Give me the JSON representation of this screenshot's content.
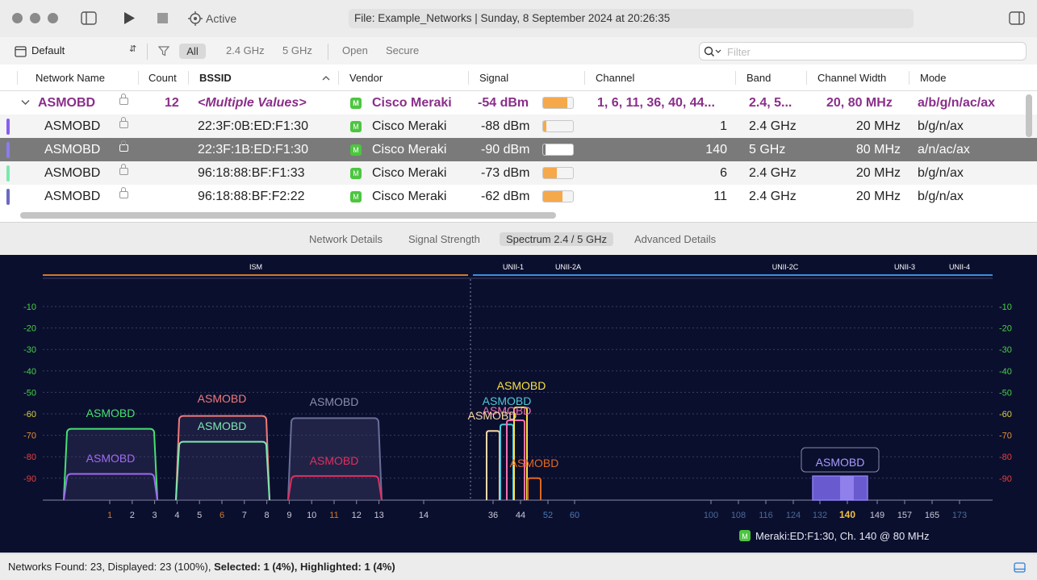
{
  "toolbar": {
    "status_label": "Active",
    "file_info": "File: Example_Networks | Sunday, 8 September 2024 at 20:26:35"
  },
  "filterbar": {
    "profile": "Default",
    "filters": [
      "All",
      "2.4 GHz",
      "5 GHz",
      "Open",
      "Secure"
    ],
    "selected_filter": "All",
    "search_placeholder": "Filter"
  },
  "table": {
    "columns": [
      "Network Name",
      "Count",
      "BSSID",
      "Vendor",
      "Signal",
      "Channel",
      "Band",
      "Channel Width",
      "Mode"
    ],
    "group": {
      "name": "ASMOBD",
      "count": "12",
      "bssid": "<Multiple Values>",
      "vendor": "Cisco Meraki",
      "signal": "-54 dBm",
      "signal_level": 0.8,
      "channel": "1, 6, 11, 36, 40, 44...",
      "band": "2.4, 5...",
      "width": "20, 80 MHz",
      "mode": "a/b/g/n/ac/ax"
    },
    "rows": [
      {
        "name": "ASMOBD",
        "bssid": "22:3F:0B:ED:F1:30",
        "vendor": "Cisco Meraki",
        "signal": "-88 dBm",
        "signal_level": 0.12,
        "channel": "1",
        "band": "2.4 GHz",
        "width": "20 MHz",
        "mode": "b/g/n/ax",
        "color": "#8a5cf0"
      },
      {
        "name": "ASMOBD",
        "bssid": "22:3F:1B:ED:F1:30",
        "vendor": "Cisco Meraki",
        "signal": "-90 dBm",
        "signal_level": 0.08,
        "channel": "140",
        "band": "5 GHz",
        "width": "80 MHz",
        "mode": "a/n/ac/ax",
        "color": "#8a7cf0"
      },
      {
        "name": "ASMOBD",
        "bssid": "96:18:88:BF:F1:33",
        "vendor": "Cisco Meraki",
        "signal": "-73 dBm",
        "signal_level": 0.45,
        "channel": "6",
        "band": "2.4 GHz",
        "width": "20 MHz",
        "mode": "b/g/n/ax",
        "color": "#7de8b0"
      },
      {
        "name": "ASMOBD",
        "bssid": "96:18:88:BF:F2:22",
        "vendor": "Cisco Meraki",
        "signal": "-62 dBm",
        "signal_level": 0.65,
        "channel": "11",
        "band": "2.4 GHz",
        "width": "20 MHz",
        "mode": "b/g/n/ax",
        "color": "#6a6ac0"
      }
    ]
  },
  "detail_tabs": [
    "Network Details",
    "Signal Strength",
    "Spectrum 2.4 / 5 GHz",
    "Advanced Details"
  ],
  "active_tab": "Spectrum 2.4 / 5 GHz",
  "spectrum": {
    "bands": [
      "ISM",
      "UNII-1",
      "UNII-2A",
      "UNII-2C",
      "UNII-3",
      "UNII-4"
    ],
    "y_ticks": [
      "-10",
      "-20",
      "-30",
      "-40",
      "-50",
      "-60",
      "-70",
      "-80",
      "-90"
    ],
    "channels_24": [
      "1",
      "2",
      "3",
      "4",
      "5",
      "6",
      "7",
      "8",
      "9",
      "10",
      "11",
      "12",
      "13",
      "14"
    ],
    "channels_5a": [
      "36",
      "44",
      "52",
      "60"
    ],
    "channels_5b": [
      "100",
      "108",
      "116",
      "124",
      "132",
      "140",
      "149",
      "157",
      "165",
      "173"
    ],
    "network_label": "ASMOBD",
    "selection_caption": "Meraki:ED:F1:30, Ch. 140 @ 80 MHz"
  },
  "status": {
    "found": "Networks Found: 23, Displayed: 23 (100%),",
    "selected": "Selected: 1 (4%),",
    "highlighted": "Highlighted: 1 (4%)"
  }
}
